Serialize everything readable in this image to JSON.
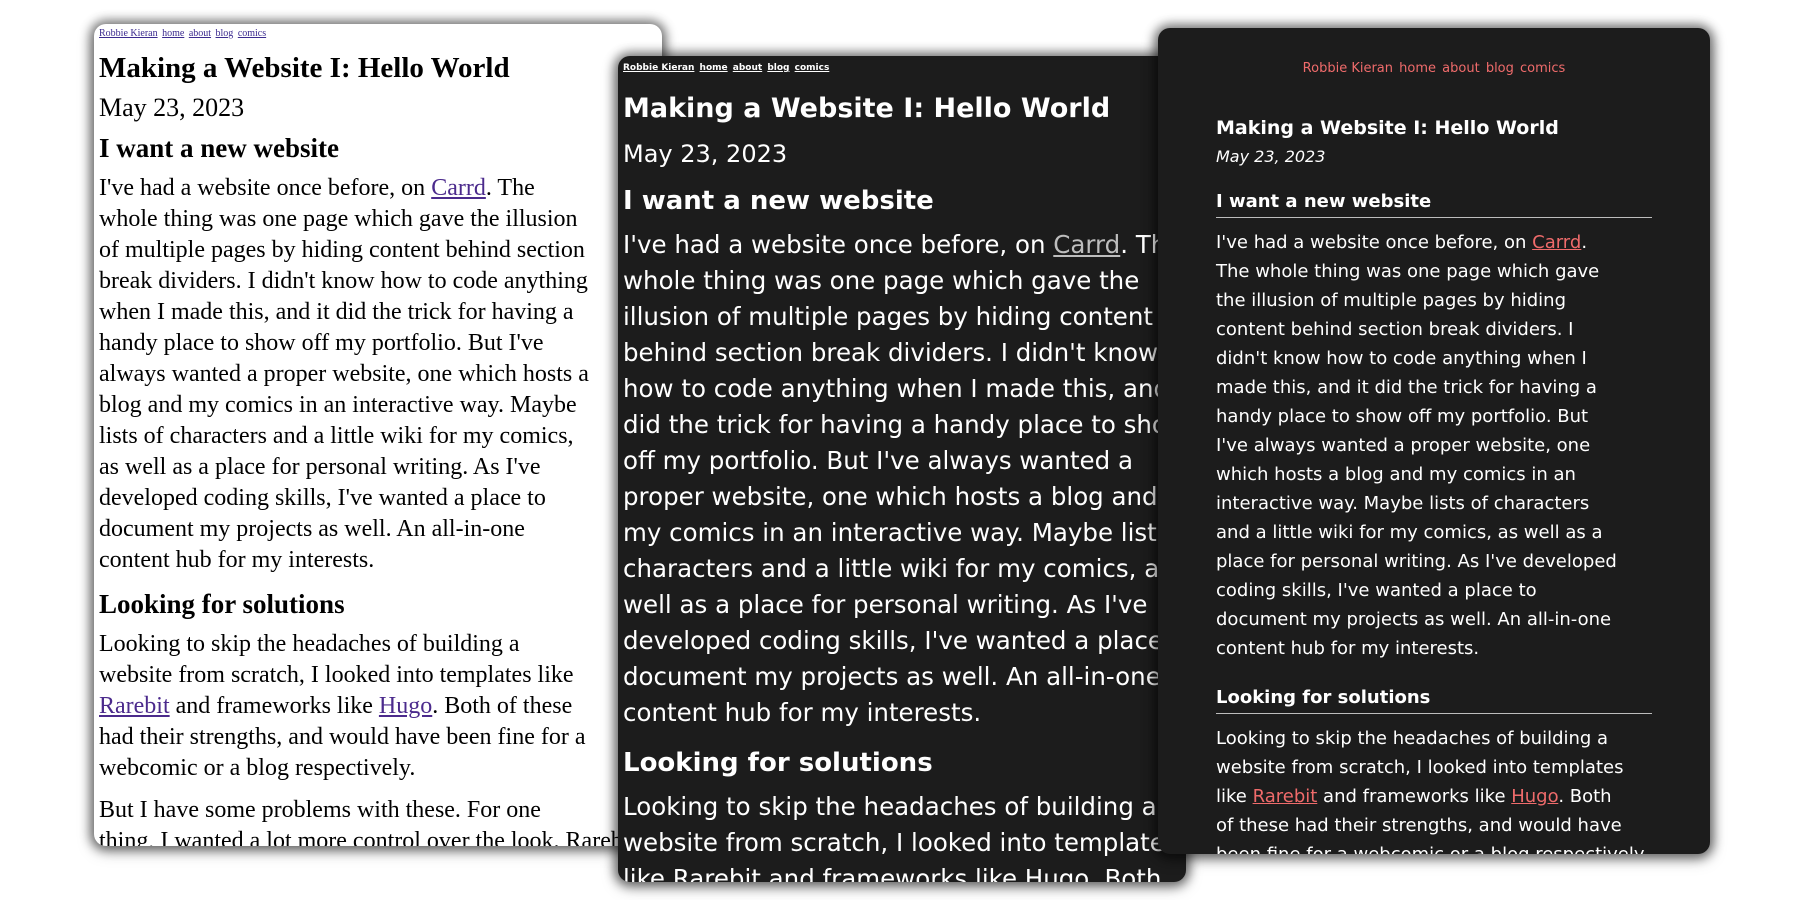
{
  "nav": {
    "site_name": "Robbie Kieran",
    "home": "home",
    "about": "about",
    "blog": "blog",
    "comics": "comics"
  },
  "post": {
    "title": "Making a Website I: Hello World",
    "date": "May 23, 2023",
    "heading1": "I want a new website",
    "heading2": "Looking for solutions"
  },
  "links": {
    "carrd": "Carrd",
    "rarebit": "Rarebit",
    "hugo": "Hugo"
  },
  "win1": {
    "intro": [
      {
        "pre": "I've had a website once before, on ",
        "link": "carrd",
        "post": ". The"
      },
      {
        "text": "whole thing was one page which gave the illusion"
      },
      {
        "text": "of multiple pages by hiding content behind section"
      },
      {
        "text": "break dividers. I didn't know how to code anything"
      },
      {
        "text": "when I made this, and it did the trick for having a"
      },
      {
        "text": "handy place to show off my portfolio. But I've"
      },
      {
        "text": "always wanted a proper website, one which hosts a"
      },
      {
        "text": "blog and my comics in an interactive way. Maybe"
      },
      {
        "text": "lists of characters and a little wiki for my comics,"
      },
      {
        "text": "as well as a place for personal writing. As I've"
      },
      {
        "text": "developed coding skills, I've wanted a place to"
      },
      {
        "text": "document my projects as well. An all-in-one"
      },
      {
        "text": "content hub for my interests."
      }
    ],
    "solutions": [
      {
        "text": "Looking to skip the headaches of building a"
      },
      {
        "text": "website from scratch, I looked into templates like"
      },
      {
        "link": "rarebit",
        "mid": " and frameworks like ",
        "link2": "hugo",
        "post": ". Both of these"
      },
      {
        "text": "had their strengths, and would have been fine for a"
      },
      {
        "text": "webcomic or a blog respectively."
      }
    ],
    "problems": [
      {
        "text": "But I have some problems with these. For one"
      },
      {
        "text": "thing, I wanted a lot more control over the look. Rarebit"
      }
    ]
  },
  "win2": {
    "intro": [
      {
        "pre": "I've had a website once before, on ",
        "link": "carrd",
        "post": ". The"
      },
      {
        "text": "whole thing was one page which gave the"
      },
      {
        "text": "illusion of multiple pages by hiding content"
      },
      {
        "text": "behind section break dividers. I didn't know"
      },
      {
        "text": "how to code anything when I made this, and it"
      },
      {
        "text": "did the trick for having a handy place to show"
      },
      {
        "text": "off my portfolio. But I've always wanted a"
      },
      {
        "text": "proper website, one which hosts a blog and"
      },
      {
        "text": "my comics in an interactive way. Maybe lists of"
      },
      {
        "text": "characters and a little wiki for my comics, as"
      },
      {
        "text": "well as a place for personal writing. As I've"
      },
      {
        "text": "developed coding skills, I've wanted a place to"
      },
      {
        "text": "document my projects as well. An all-in-one"
      },
      {
        "text": "content hub for my interests."
      }
    ],
    "solutions": [
      {
        "text": "Looking to skip the headaches of building a"
      },
      {
        "text": "website from scratch, I looked into templates"
      },
      {
        "text": "like Rarebit and frameworks like Hugo. Both"
      }
    ]
  },
  "win3": {
    "intro": [
      {
        "pre": "I've had a website once before, on ",
        "link": "carrd",
        "post": "."
      },
      {
        "text": "The whole thing was one page which gave"
      },
      {
        "text": "the illusion of multiple pages by hiding"
      },
      {
        "text": "content behind section break dividers. I"
      },
      {
        "text": "didn't know how to code anything when I"
      },
      {
        "text": "made this, and it did the trick for having a"
      },
      {
        "text": "handy place to show off my portfolio. But"
      },
      {
        "text": "I've always wanted a proper website, one"
      },
      {
        "text": "which hosts a blog and my comics in an"
      },
      {
        "text": "interactive way. Maybe lists of characters"
      },
      {
        "text": "and a little wiki for my comics, as well as a"
      },
      {
        "text": "place for personal writing. As I've developed"
      },
      {
        "text": "coding skills, I've wanted a place to"
      },
      {
        "text": "document my projects as well. An all-in-one"
      },
      {
        "text": "content hub for my interests."
      }
    ],
    "solutions": [
      {
        "text": "Looking to skip the headaches of building a"
      },
      {
        "text": "website from scratch, I looked into templates"
      },
      {
        "pre": "like ",
        "link": "rarebit",
        "mid": " and frameworks like ",
        "link2": "hugo",
        "post": ". Both"
      },
      {
        "text": "of these had their strengths, and would have"
      },
      {
        "text": "been fine for a webcomic or a blog respectively."
      }
    ]
  }
}
